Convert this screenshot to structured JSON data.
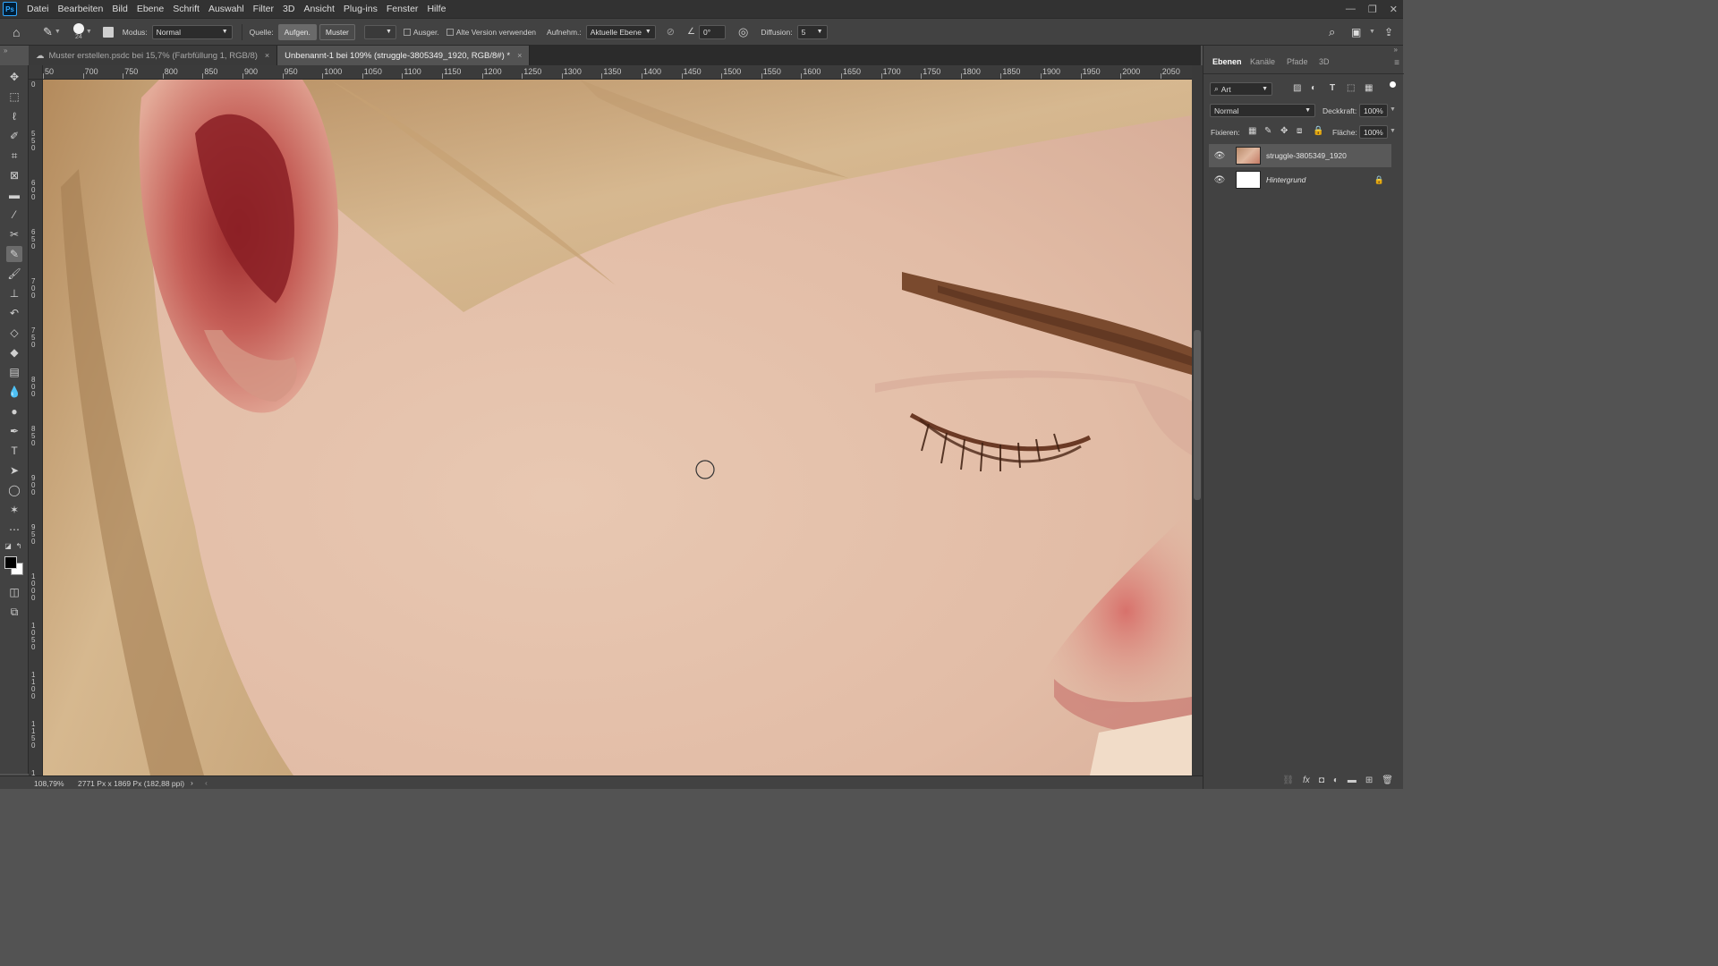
{
  "app": {
    "logo": "Ps"
  },
  "menu": [
    "Datei",
    "Bearbeiten",
    "Bild",
    "Ebene",
    "Schrift",
    "Auswahl",
    "Filter",
    "3D",
    "Ansicht",
    "Plug-ins",
    "Fenster",
    "Hilfe"
  ],
  "options": {
    "brush_size": "24",
    "modus_label": "Modus:",
    "modus_value": "Normal",
    "quelle_label": "Quelle:",
    "aufgen_button": "Aufgen.",
    "muster_button": "Muster",
    "ausger_label": "Ausger.",
    "alte_version_label": "Alte Version verwenden",
    "aufnehm_label": "Aufnehm.:",
    "aufnehm_value": "Aktuelle Ebene",
    "angle_value": "0°",
    "diffusion_label": "Diffusion:",
    "diffusion_value": "5"
  },
  "tabs": [
    {
      "label": "Muster erstellen.psdc bei 15,7% (Farbfüllung 1, RGB/8)",
      "close": "×"
    },
    {
      "label": "Unbenannt-1 bei 109% (struggle-3805349_1920, RGB/8#) *",
      "close": "×"
    }
  ],
  "ruler": {
    "top_ticks": [
      "50",
      "700",
      "750",
      "800",
      "850",
      "900",
      "950",
      "1000",
      "1050",
      "1100",
      "1150",
      "1200",
      "1250",
      "1300",
      "1350",
      "1400",
      "1450",
      "1500",
      "1550",
      "1600",
      "1650",
      "1700",
      "1750",
      "1800",
      "1850",
      "1900",
      "1950",
      "2000",
      "2050"
    ],
    "left_ticks": [
      "0",
      "550",
      "600",
      "650",
      "700",
      "750",
      "800",
      "850",
      "900",
      "950",
      "1000",
      "1050",
      "1100",
      "1150",
      "1200"
    ]
  },
  "status": {
    "zoom": "108,79%",
    "doc_info": "2771 Px x 1869 Px (182,88 ppi)"
  },
  "layers_panel": {
    "tabs": [
      "Ebenen",
      "Kanäle",
      "Pfade",
      "3D"
    ],
    "filter_label": "Art",
    "blend_mode": "Normal",
    "opacity_label": "Deckkraft:",
    "opacity_value": "100%",
    "lock_label": "Fixieren:",
    "fill_label": "Fläche:",
    "fill_value": "100%",
    "layers": [
      {
        "name": "struggle-3805349_1920",
        "visible": true,
        "selected": true
      },
      {
        "name": "Hintergrund",
        "visible": true,
        "selected": false,
        "locked": true
      }
    ]
  },
  "colors": {
    "accent": "#31a8ff",
    "ui_dark": "#323232",
    "ui_panel": "#424242"
  }
}
